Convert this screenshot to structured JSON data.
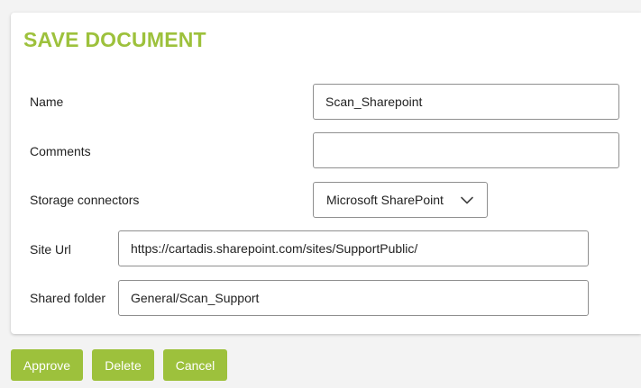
{
  "dialog": {
    "title": "SAVE DOCUMENT"
  },
  "form": {
    "name": {
      "label": "Name",
      "value": "Scan_Sharepoint"
    },
    "comments": {
      "label": "Comments",
      "value": ""
    },
    "storage": {
      "label": "Storage connectors",
      "selected": "Microsoft SharePoint",
      "icon": "chevron-down-icon"
    },
    "site_url": {
      "label": "Site Url",
      "value": "https://cartadis.sharepoint.com/sites/SupportPublic/"
    },
    "shared_folder": {
      "label": "Shared folder",
      "value": "General/Scan_Support"
    }
  },
  "actions": {
    "approve": "Approve",
    "delete": "Delete",
    "cancel": "Cancel"
  },
  "colors": {
    "accent": "#9dc13c",
    "border": "#8f8f8f",
    "background": "#f3f3f3"
  }
}
